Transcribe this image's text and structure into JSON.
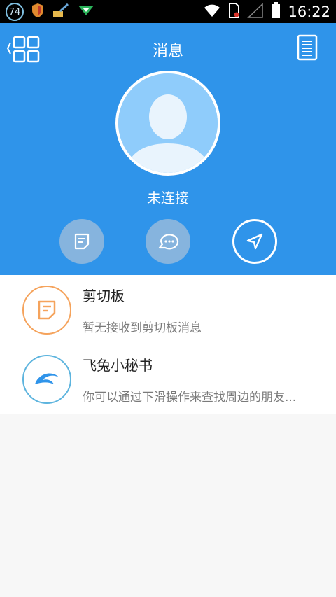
{
  "statusbar": {
    "badge": "74",
    "time": "16:22",
    "icons": [
      "notification-74-icon",
      "shield-icon",
      "broom-icon",
      "download-arrow-icon",
      "wifi-icon",
      "sim-icon",
      "signal-icon",
      "battery-icon"
    ]
  },
  "header": {
    "title": "消息",
    "connection_status": "未连接",
    "accent_color": "#2f94ea"
  },
  "messages": [
    {
      "title": "剪切板",
      "subtitle": "暂无接收到剪切板消息",
      "icon": "clipboard-note-icon",
      "icon_color": "#f5a35c"
    },
    {
      "title": "飞兔小秘书",
      "subtitle": "你可以通过下滑操作来查找周边的朋友...",
      "icon": "feitu-logo-icon",
      "icon_color": "#5db4de"
    }
  ]
}
